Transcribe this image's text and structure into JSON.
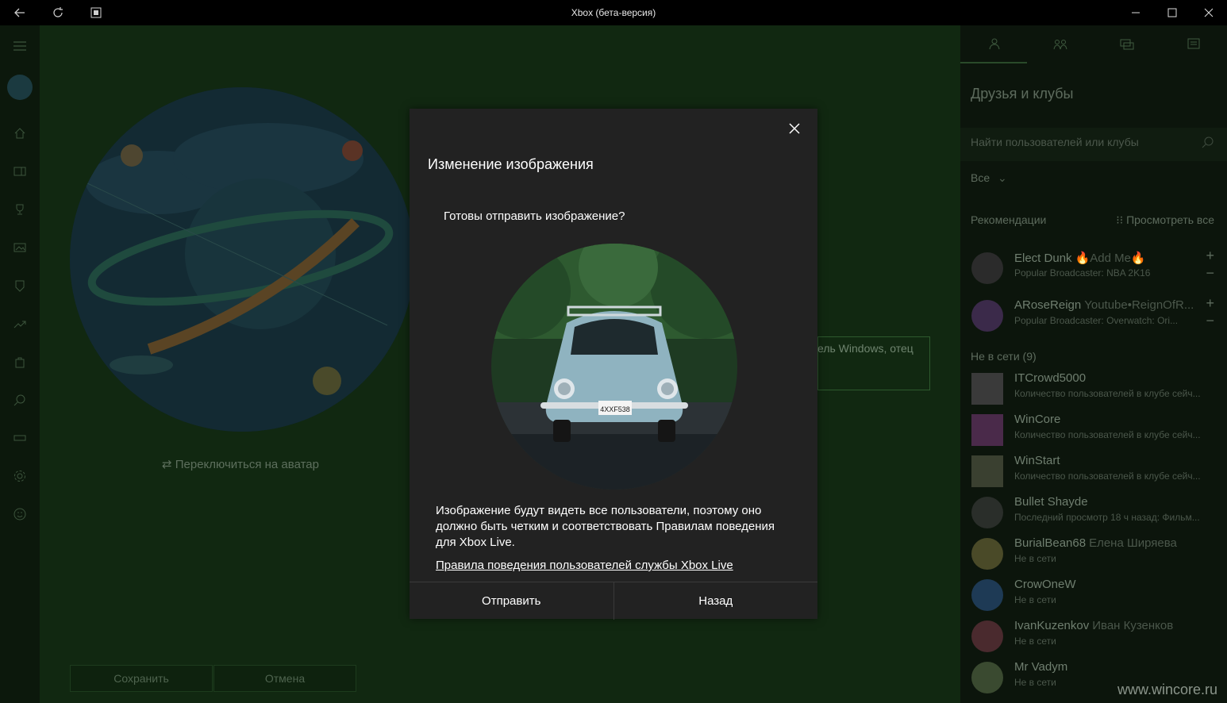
{
  "window": {
    "title": "Xbox (бета-версия)"
  },
  "left_nav": {
    "items": [
      "menu-icon",
      "profile-avatar",
      "home-icon",
      "store-icon",
      "achievements-icon",
      "captures-icon",
      "clubs-icon",
      "trending-icon",
      "store-bag-icon",
      "search-icon",
      "connection-icon",
      "settings-icon",
      "smiley-icon"
    ]
  },
  "main": {
    "switch_label": "Переключиться на аватар",
    "bio_partial": "ель Windows, отец",
    "save_label": "Сохранить",
    "cancel_label": "Отмена"
  },
  "dialog": {
    "title": "Изменение изображения",
    "question": "Готовы отправить изображение?",
    "body": "Изображение будут видеть все пользователи, поэтому оно должно быть четким и соответствовать Правилам поведения для Xbox Live.",
    "link": "Правила поведения пользователей службы Xbox Live",
    "send_label": "Отправить",
    "back_label": "Назад",
    "plate_text": "4XXF538"
  },
  "right_panel": {
    "title": "Друзья и клубы",
    "search_placeholder": "Найти пользователей или клубы",
    "filter": "Все",
    "recommendations_label": "Рекомендации",
    "view_all": "Просмотреть все",
    "online_label": "Не в сети (9)",
    "recommendations": [
      {
        "name": "Elect Dunk",
        "real": "🔥Add Me🔥",
        "status": "Popular Broadcaster: NBA 2K16"
      },
      {
        "name": "ARoseReign",
        "real": "Youtube•ReignOfR...",
        "status": "Popular Broadcaster: Overwatch: Ori..."
      }
    ],
    "people": [
      {
        "name": "ITCrowd5000",
        "real": "",
        "status": "Количество пользователей в клубе сейч..."
      },
      {
        "name": "WinCore",
        "real": "",
        "status": "Количество пользователей в клубе сейч..."
      },
      {
        "name": "WinStart",
        "real": "",
        "status": "Количество пользователей в клубе сейч..."
      },
      {
        "name": "Bullet Shayde",
        "real": "",
        "status": "Последний просмотр 18 ч назад: Фильм..."
      },
      {
        "name": "BurialBean68",
        "real": "Елена Ширяева",
        "status": "Не в сети"
      },
      {
        "name": "CrowOneW",
        "real": "",
        "status": "Не в сети"
      },
      {
        "name": "IvanKuzenkov",
        "real": "Иван Кузенков",
        "status": "Не в сети"
      },
      {
        "name": "Mr Vadym",
        "real": "",
        "status": "Не в сети"
      }
    ]
  },
  "watermark": "www.wincore.ru"
}
